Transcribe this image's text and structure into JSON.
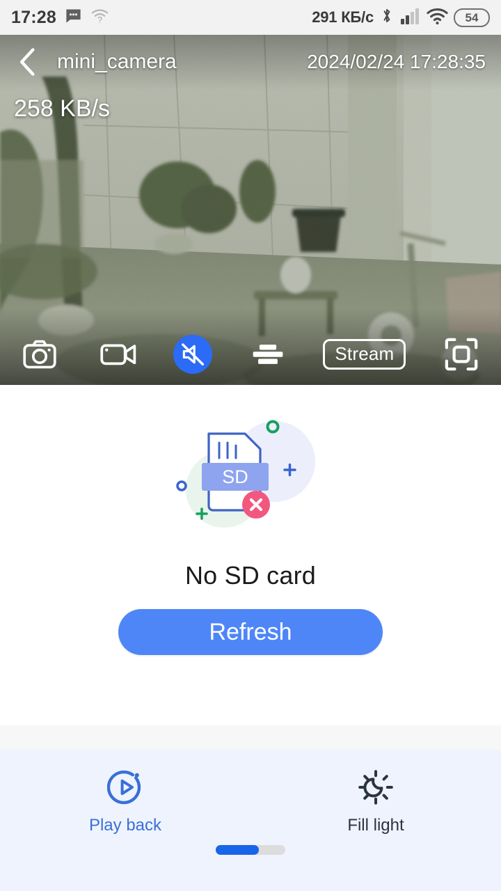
{
  "statusbar": {
    "time": "17:28",
    "network_speed": "291 КБ/с",
    "battery_level": "54",
    "icons": [
      "message-icon",
      "wifi-question-icon",
      "bluetooth-icon",
      "cellular-signal-icon",
      "wifi-icon",
      "battery-icon"
    ]
  },
  "video": {
    "back_icon": "back-chevron-icon",
    "title": "mini_camera",
    "timestamp": "2024/02/24 17:28:35",
    "bitrate": "258 KB/s",
    "toolbar": [
      {
        "name": "snapshot",
        "icon": "camera-icon",
        "active": false,
        "label": ""
      },
      {
        "name": "record",
        "icon": "video-camera-icon",
        "active": false,
        "label": ""
      },
      {
        "name": "mute",
        "icon": "speaker-muted-icon",
        "active": true,
        "label": ""
      },
      {
        "name": "quality",
        "icon": "bars-settings-icon",
        "active": false,
        "label": ""
      },
      {
        "name": "stream",
        "icon": "stream-pill",
        "active": false,
        "label": "Stream"
      },
      {
        "name": "fullscreen",
        "icon": "fullscreen-icon",
        "active": false,
        "label": ""
      }
    ]
  },
  "content": {
    "illustration": "sd-card-error-icon",
    "sd_card_label": "SD",
    "empty_text": "No SD card",
    "refresh_label": "Refresh"
  },
  "bottom": {
    "actions": [
      {
        "label": "Play back",
        "icon": "play-circle-icon",
        "active": true
      },
      {
        "label": "Fill light",
        "icon": "moon-sun-icon",
        "active": false
      }
    ],
    "page_indicator": {
      "pages": 2,
      "current": 1
    }
  },
  "colors": {
    "accent_blue": "#2b6bf5",
    "button_blue": "#4e86f7",
    "panel_blue": "#eef3fe",
    "playback_blue": "#3a6fd8",
    "status_gray": "#f2f2f2"
  }
}
